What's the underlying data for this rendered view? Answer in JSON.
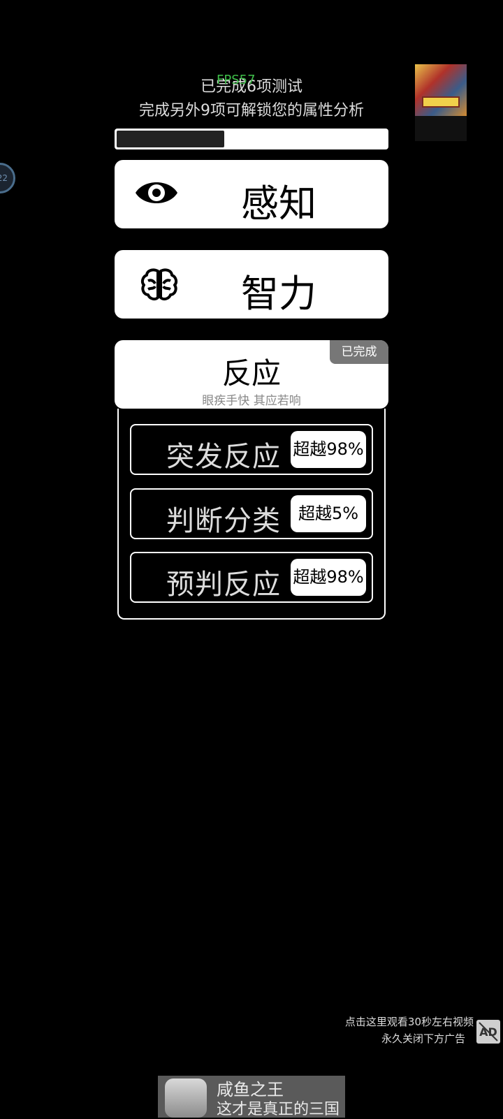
{
  "header": {
    "completed_text": "已完成6项测试",
    "unlock_text": "完成另外9项可解锁您的属性分析",
    "fps_overlay": "FPS57",
    "progress_fraction": 0.4
  },
  "side_badge": {
    "text": "22"
  },
  "categories": [
    {
      "label": "感知",
      "icon": "eye-icon"
    },
    {
      "label": "智力",
      "icon": "brain-icon"
    },
    {
      "label": "反应",
      "subtitle": "眼疾手快 其应若响",
      "status": "已完成",
      "tests": [
        {
          "name": "突发反应",
          "score": "超越98%"
        },
        {
          "name": "判断分类",
          "score": "超越5%"
        },
        {
          "name": "预判反应",
          "score": "超越98%"
        }
      ]
    }
  ],
  "ad": {
    "hint_line1": "点击这里观看30秒左右视频",
    "hint_line2": "永久关闭下方广告",
    "close_icon_label": "AD",
    "banner_title": "咸鱼之王",
    "banner_desc": "这才是真正的三国"
  }
}
